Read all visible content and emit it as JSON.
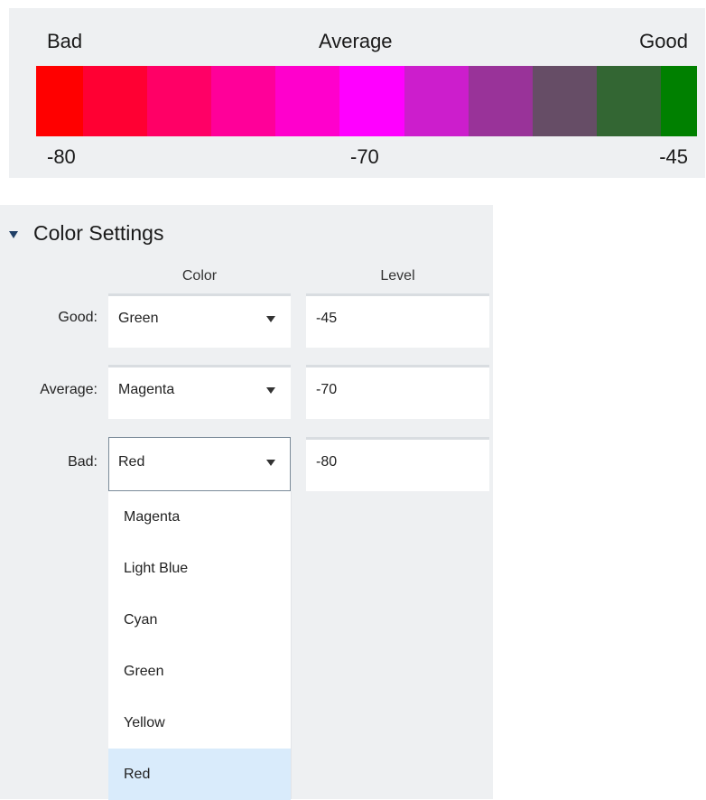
{
  "legend": {
    "labels": {
      "bad": "Bad",
      "average": "Average",
      "good": "Good"
    },
    "values": {
      "low": "-80",
      "mid": "-70",
      "high": "-45"
    },
    "gradient_colors": [
      "#ff0000",
      "#ff0033",
      "#ff0066",
      "#ff0099",
      "#ff00cc",
      "#ff00ff",
      "#cc1ecc",
      "#993399",
      "#664d66",
      "#336633",
      "#008000"
    ]
  },
  "color_settings": {
    "title": "Color Settings",
    "columns": {
      "color": "Color",
      "level": "Level"
    },
    "rows": [
      {
        "label": "Good:",
        "color": "Green",
        "level": "-45"
      },
      {
        "label": "Average:",
        "color": "Magenta",
        "level": "-70"
      },
      {
        "label": "Bad:",
        "color": "Red",
        "level": "-80"
      }
    ],
    "dropdown": {
      "open_row": "Bad",
      "options": [
        "Magenta",
        "Light Blue",
        "Cyan",
        "Green",
        "Yellow",
        "Red"
      ],
      "selected": "Red"
    }
  }
}
